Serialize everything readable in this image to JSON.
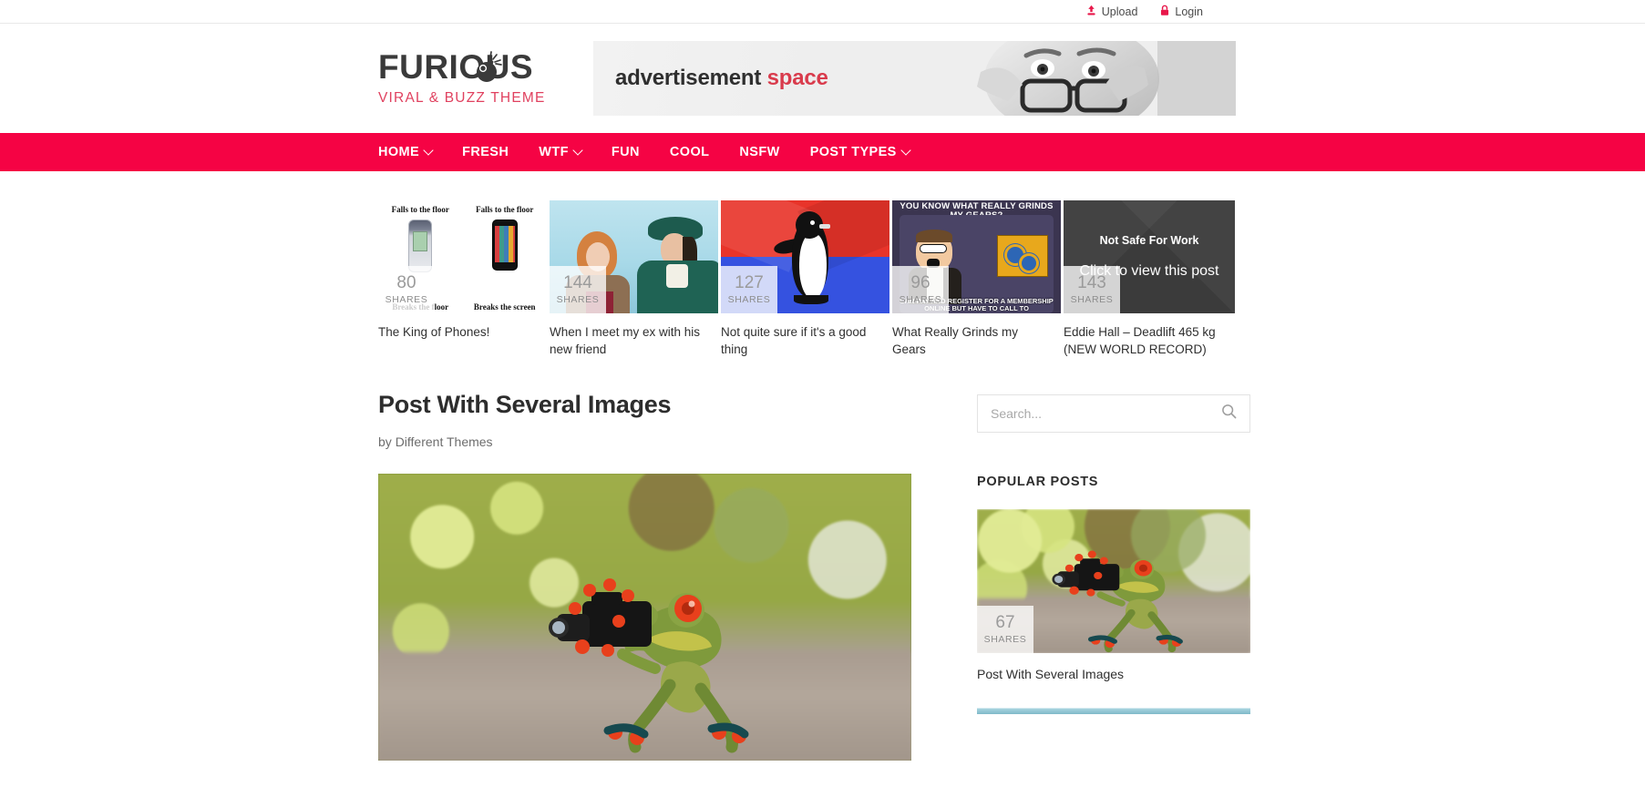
{
  "topbar": {
    "upload": {
      "label": "Upload",
      "icon": "upload-icon"
    },
    "login": {
      "label": "Login",
      "icon": "lock-icon"
    }
  },
  "header": {
    "logo": {
      "main": "FURIOUS",
      "sub": "VIRAL & BUZZ THEME",
      "bomb_icon": "bomb-icon"
    },
    "ad": {
      "text_dark": "advertisement",
      "text_accent": "space"
    }
  },
  "nav": {
    "items": [
      {
        "label": "HOME",
        "has_dropdown": true
      },
      {
        "label": "FRESH",
        "has_dropdown": false
      },
      {
        "label": "WTF",
        "has_dropdown": true
      },
      {
        "label": "FUN",
        "has_dropdown": false
      },
      {
        "label": "COOL",
        "has_dropdown": false
      },
      {
        "label": "NSFW",
        "has_dropdown": false
      },
      {
        "label": "POST TYPES",
        "has_dropdown": true
      }
    ]
  },
  "featured": {
    "cards": [
      {
        "title": "The King of Phones!",
        "shares": "80",
        "shares_label": "SHARES",
        "meme": {
          "top_left": "Falls to the floor",
          "top_right": "Falls to the floor",
          "bottom_left": "Breaks the floor",
          "bottom_right": "Breaks the screen"
        }
      },
      {
        "title": "When I meet my ex with his new friend",
        "shares": "144",
        "shares_label": "SHARES"
      },
      {
        "title": "Not quite sure if it's a good thing",
        "shares": "127",
        "shares_label": "SHARES"
      },
      {
        "title": "What Really Grinds my Gears",
        "shares": "96",
        "shares_label": "SHARES",
        "meme": {
          "headline": "YOU KNOW WHAT REALLY GRINDS MY GEARS?",
          "subtitle": "CAN PAY AND REGISTER FOR A MEMBERSHIP ONLINE BUT HAVE TO CALL TO"
        }
      },
      {
        "title": "Eddie Hall – Deadlift 465 kg (NEW WORLD RECORD)",
        "shares": "143",
        "shares_label": "SHARES",
        "nsfw_title": "Not Safe For Work",
        "nsfw_cta": "Click to view this post"
      }
    ]
  },
  "article": {
    "title": "Post With Several Images",
    "by_prefix": "by",
    "author": "Different Themes",
    "hero_alt": "frog-with-camera-photo"
  },
  "sidebar": {
    "search": {
      "placeholder": "Search...",
      "value": "",
      "icon": "search-icon"
    },
    "popular": {
      "heading": "POPULAR POSTS",
      "posts": [
        {
          "title": "Post With Several Images",
          "shares": "67",
          "shares_label": "SHARES"
        }
      ]
    }
  },
  "colors": {
    "brand_red": "#f50344",
    "accent_red": "#d93b4c",
    "logo_sub": "#e0415f",
    "text_dark": "#2d2d2d",
    "muted": "#8d8d8d"
  }
}
